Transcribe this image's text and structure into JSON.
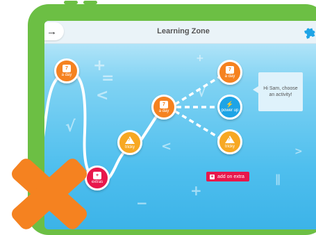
{
  "header": {
    "title": "Learning Zone",
    "back_glyph": "→",
    "back_icon": "arrow-right-icon",
    "menu_icon": "puzzle-icon"
  },
  "nodes": [
    {
      "label": "a day",
      "badge": "7",
      "icon": "calendar-icon",
      "color": "#f58220"
    },
    {
      "label": "extras",
      "badge": "+",
      "icon": "plus-box-icon",
      "color": "#e8174b"
    },
    {
      "label": "tricky",
      "badge": "?",
      "icon": "warning-triangle-icon",
      "color": "#f7a823"
    },
    {
      "label": "a day",
      "badge": "7",
      "icon": "calendar-icon",
      "color": "#f58220"
    },
    {
      "label": "a day",
      "badge": "7",
      "icon": "calendar-icon",
      "color": "#f58220"
    },
    {
      "label": "power up",
      "badge": "⚡",
      "icon": "bolt-icon",
      "color": "#1ea4e6"
    },
    {
      "label": "tricky",
      "badge": "?",
      "icon": "warning-triangle-icon",
      "color": "#f7a823"
    }
  ],
  "speech_bubble": {
    "text": "Hi Sam, choose an activity!"
  },
  "add_extra_button": {
    "label": "add on extra",
    "icon": "plus-icon"
  },
  "overlay": {
    "icon": "cross-icon",
    "color": "#f58220"
  },
  "colors": {
    "frame": "#6cbf44",
    "accent_red": "#e8174b",
    "orange": "#f58220",
    "sky": "#4fbfee"
  }
}
